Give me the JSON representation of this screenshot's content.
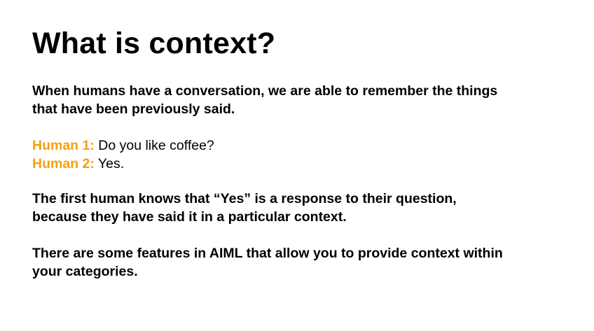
{
  "slide": {
    "title": "What is context?",
    "intro_line1": "When humans have a conversation, we are able to remember the things",
    "intro_line2": "that have been previously said.",
    "dialogue": [
      {
        "speaker": "Human 1:",
        "text": " Do you like coffee?"
      },
      {
        "speaker": "Human 2:",
        "text": " Yes."
      }
    ],
    "explanation_line1": "The first human knows that “Yes” is a response to their question,",
    "explanation_line2": "because they have said it in a particular context.",
    "aiml_line1": "There are some features in AIML that allow you to provide context within",
    "aiml_line2": "your categories.",
    "colors": {
      "speaker": "#f5a10f",
      "text": "#000000",
      "background": "#ffffff"
    }
  }
}
